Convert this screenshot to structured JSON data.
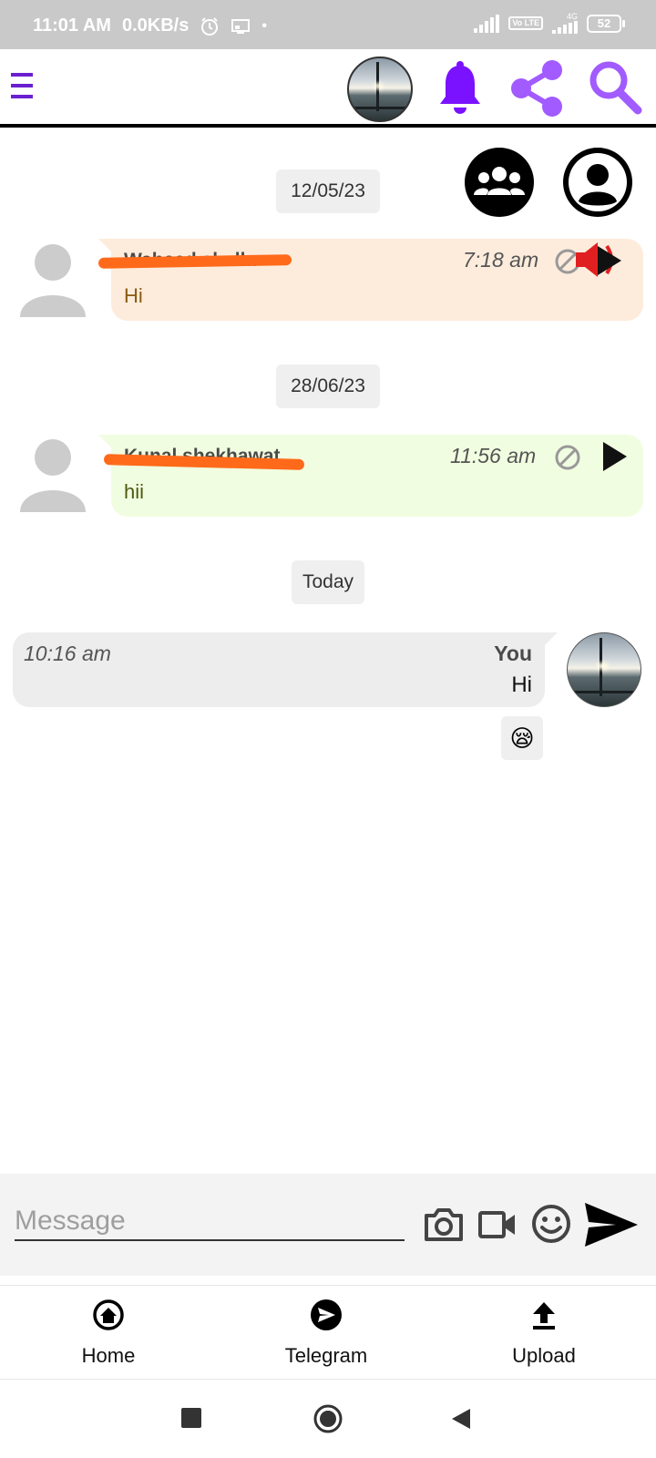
{
  "status_bar": {
    "time": "11:01 AM",
    "speed": "0.0KB/s",
    "volte": "Vo LTE",
    "network": "4G",
    "battery": "52"
  },
  "app_bar": {
    "menu_icon": "hamburger-menu-icon",
    "icons": [
      "profile-avatar",
      "bell-icon",
      "share-icon",
      "search-icon"
    ],
    "accent_color": "#7a12ff"
  },
  "chat": {
    "messages": [
      {
        "date": "12/05/23",
        "sender": "Waheed shalla",
        "time": "7:18 am",
        "text": "Hi",
        "bubble_color": "#fdecdc",
        "text_color": "#8a5a10",
        "icons": [
          "block-icon",
          "speaker-muted-icon",
          "play-icon"
        ]
      },
      {
        "date": "28/06/23",
        "sender": "Kunal shekhawat",
        "time": "11:56 am",
        "text": "hii",
        "bubble_color": "#f1fde0",
        "text_color": "#4d5a10",
        "icons": [
          "block-icon",
          "play-icon"
        ]
      },
      {
        "date": "Today",
        "sender": "You",
        "time": "10:16 am",
        "text": "Hi",
        "reaction": "😪",
        "bubble_color": "#ededed"
      }
    ]
  },
  "composer": {
    "placeholder": "Message",
    "icons": [
      "camera-icon",
      "video-camera-icon",
      "emoji-icon",
      "send-icon"
    ]
  },
  "bottom_nav": [
    {
      "label": "Home",
      "icon": "home-icon"
    },
    {
      "label": "Telegram",
      "icon": "telegram-icon"
    },
    {
      "label": "Upload",
      "icon": "upload-icon"
    }
  ],
  "system_nav": [
    "recents-square-icon",
    "home-circle-icon",
    "back-triangle-icon"
  ]
}
